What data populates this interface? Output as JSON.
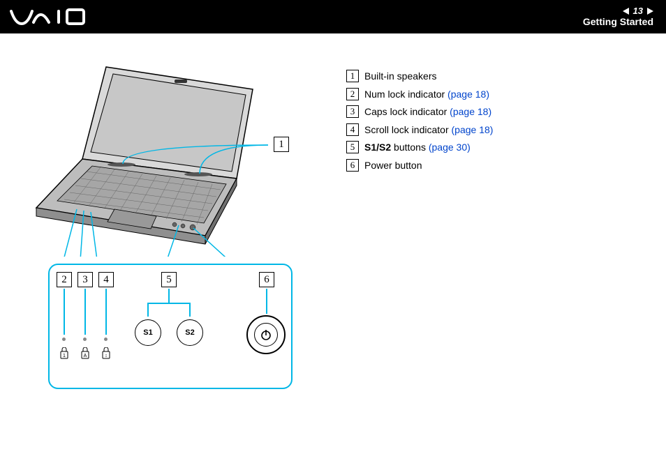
{
  "header": {
    "logo_alt": "VAIO",
    "page_number": "13",
    "section": "Getting Started"
  },
  "callouts": {
    "c1": "1",
    "c2": "2",
    "c3": "3",
    "c4": "4",
    "c5": "5",
    "c6": "6"
  },
  "detail": {
    "s1": "S1",
    "s2": "S2",
    "lock1": "1",
    "lockA": "A",
    "lock3": "1"
  },
  "legend": [
    {
      "num": "1",
      "text": "Built-in speakers",
      "bold": "",
      "ref": ""
    },
    {
      "num": "2",
      "text": "Num lock indicator ",
      "bold": "",
      "ref": "(page 18)"
    },
    {
      "num": "3",
      "text": "Caps lock indicator ",
      "bold": "",
      "ref": "(page 18)"
    },
    {
      "num": "4",
      "text": "Scroll lock indicator ",
      "bold": "",
      "ref": "(page 18)"
    },
    {
      "num": "5",
      "text": " buttons ",
      "bold": "S1/S2",
      "ref": "(page 30)"
    },
    {
      "num": "6",
      "text": "Power button",
      "bold": "",
      "ref": ""
    }
  ]
}
